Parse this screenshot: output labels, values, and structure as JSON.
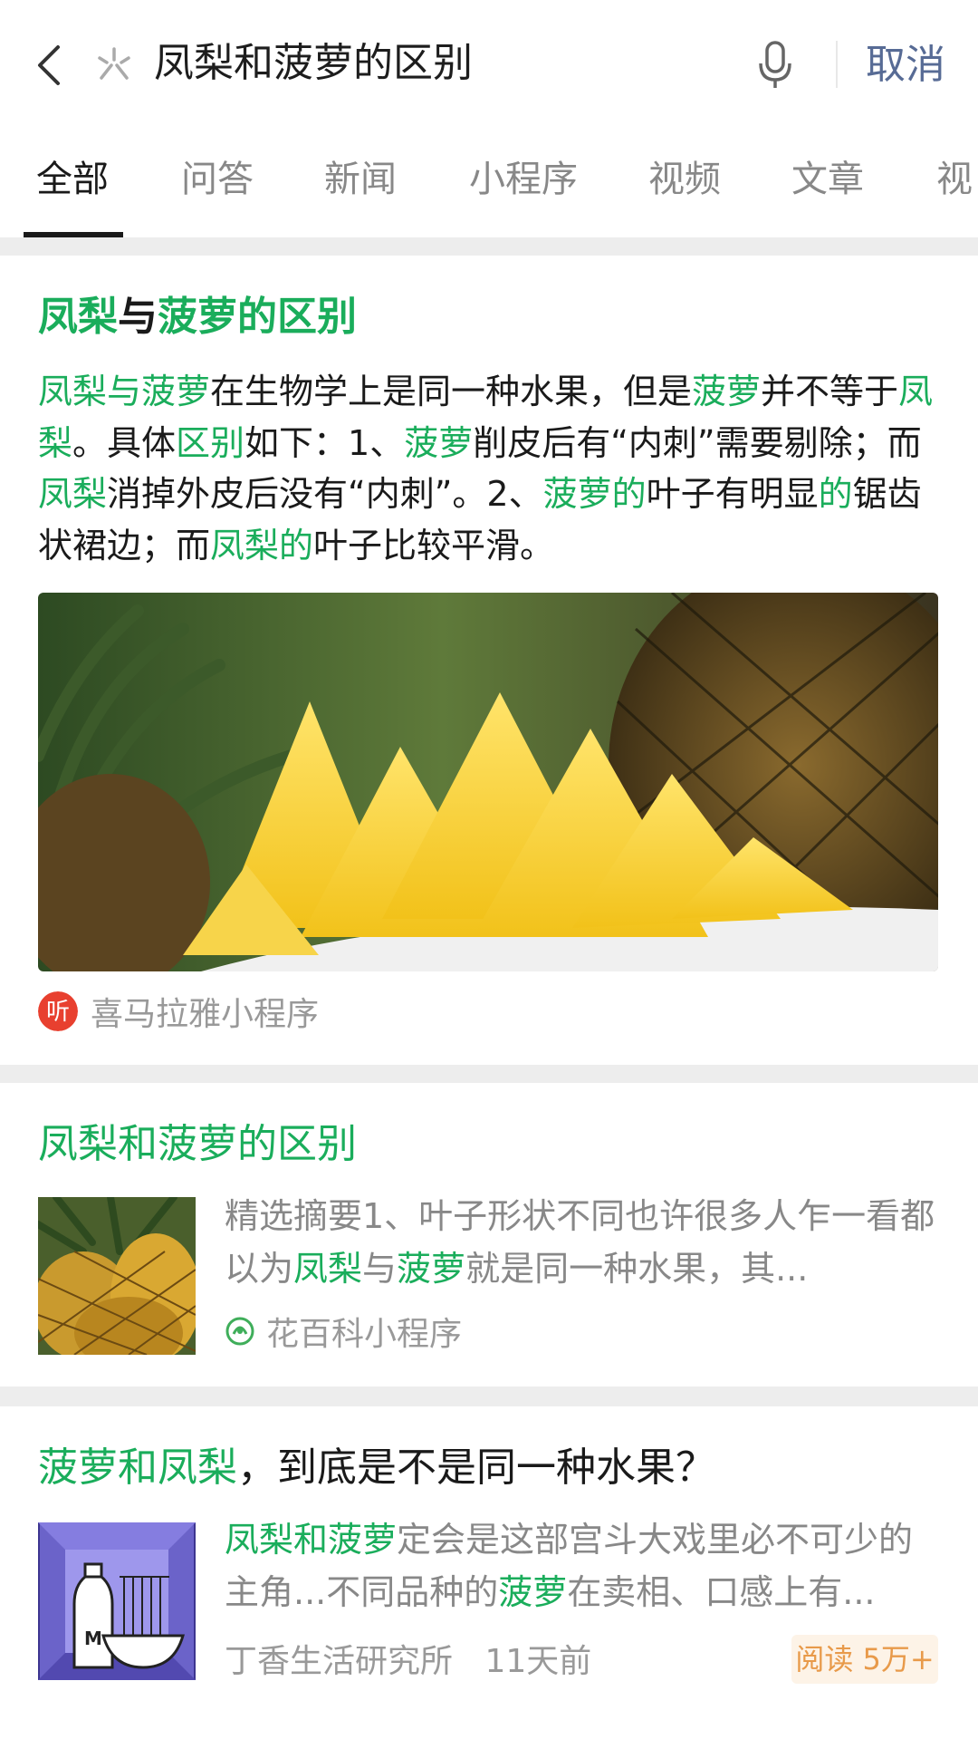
{
  "header": {
    "search_query": "凤梨和菠萝的区别",
    "cancel_label": "取消",
    "icons": {
      "back": "back-arrow-icon",
      "search": "search-spark-icon",
      "mic": "microphone-icon"
    }
  },
  "tabs": [
    {
      "label": "全部",
      "active": true
    },
    {
      "label": "问答"
    },
    {
      "label": "新闻"
    },
    {
      "label": "小程序"
    },
    {
      "label": "视频"
    },
    {
      "label": "文章"
    },
    {
      "label": "视"
    }
  ],
  "colors": {
    "highlight": "#1aad5b",
    "link_blue": "#576b95",
    "gap": "#ededed",
    "badge_bg": "#fdf3e7",
    "badge_text": "#e89a4a"
  },
  "results": [
    {
      "title_parts": [
        {
          "text": "凤梨",
          "hl": true
        },
        {
          "text": "与",
          "hl": false
        },
        {
          "text": "菠萝的区别",
          "hl": true
        }
      ],
      "snippet_parts": [
        {
          "text": "凤梨与菠萝",
          "hl": true
        },
        {
          "text": "在生物学上是同一种水果，但是",
          "hl": false
        },
        {
          "text": "菠萝",
          "hl": true
        },
        {
          "text": "并不等于",
          "hl": false
        },
        {
          "text": "凤梨",
          "hl": true
        },
        {
          "text": "。具体",
          "hl": false
        },
        {
          "text": "区别",
          "hl": true
        },
        {
          "text": "如下：1、",
          "hl": false
        },
        {
          "text": "菠萝",
          "hl": true
        },
        {
          "text": "削皮后有“内刺”需要剔除；而",
          "hl": false
        },
        {
          "text": "凤梨",
          "hl": true
        },
        {
          "text": "消掉外皮后没有“内刺”。2、",
          "hl": false
        },
        {
          "text": "菠萝的",
          "hl": true
        },
        {
          "text": "叶子有明显",
          "hl": false
        },
        {
          "text": "的",
          "hl": true
        },
        {
          "text": "锯齿状裙边；而",
          "hl": false
        },
        {
          "text": "凤梨的",
          "hl": true
        },
        {
          "text": "叶子比较平滑。",
          "hl": false
        }
      ],
      "source": "喜马拉雅小程序",
      "source_icon": "ximalaya-listen-icon",
      "source_icon_glyph": "听",
      "image": "pineapple-slices-photo"
    },
    {
      "title_parts": [
        {
          "text": "凤梨和菠萝的区别",
          "hl": true
        }
      ],
      "desc_parts": [
        {
          "text": "精选摘要1、叶子形状不同也许很多人乍一看都以为",
          "hl": false
        },
        {
          "text": "凤梨",
          "hl": true
        },
        {
          "text": "与",
          "hl": false
        },
        {
          "text": "菠萝",
          "hl": true
        },
        {
          "text": "就是同一种水果，其...",
          "hl": false
        }
      ],
      "source": "花百科小程序",
      "source_icon": "huabaike-flower-icon",
      "image": "pineapples-thumbnail"
    },
    {
      "title_parts": [
        {
          "text": "菠萝和凤梨",
          "hl": true
        },
        {
          "text": "，到底是不是同一种水果？",
          "hl": false
        }
      ],
      "desc_parts": [
        {
          "text": "凤梨和菠萝",
          "hl": true
        },
        {
          "text": "定会是这部宫斗大戏里必不可少的主角...不同品种的",
          "hl": false
        },
        {
          "text": "菠萝",
          "hl": true
        },
        {
          "text": "在卖相、口感上有...",
          "hl": false
        }
      ],
      "source": "丁香生活研究所",
      "time": "11天前",
      "read_label": "阅读 5万+",
      "image": "milk-bowl-illustration"
    }
  ]
}
